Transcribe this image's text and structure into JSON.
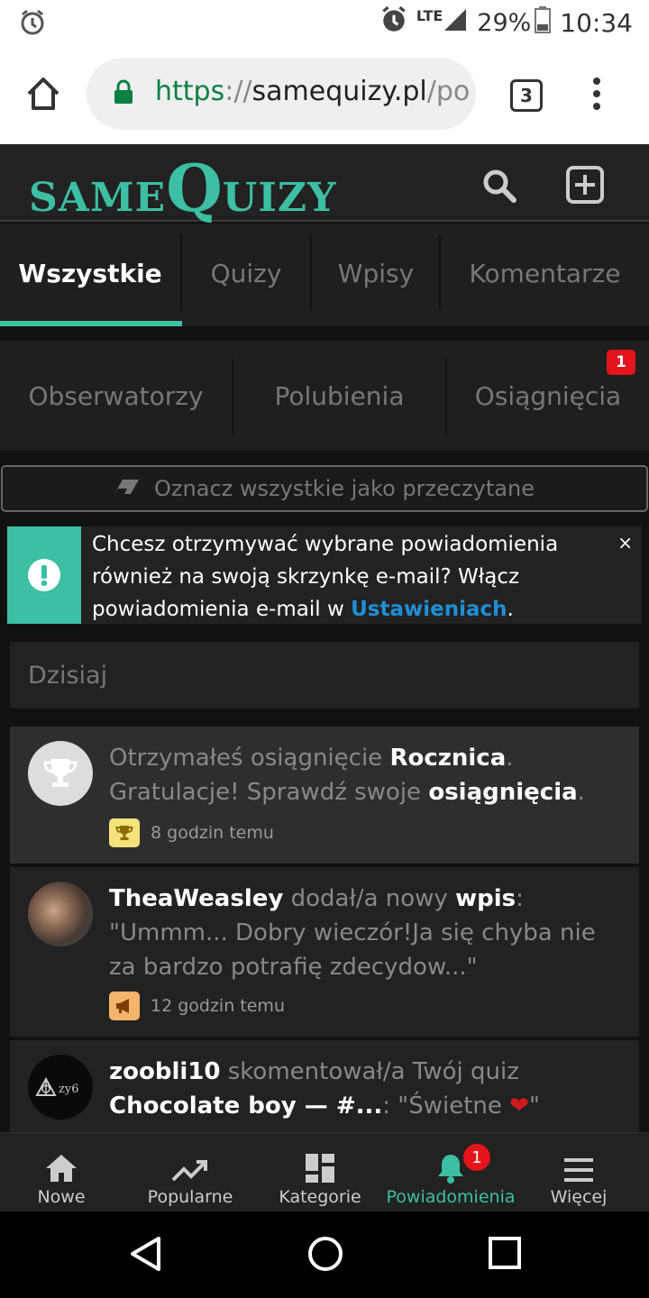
{
  "status_bar": {
    "lte": "LTE",
    "battery": "29%",
    "time": "10:34"
  },
  "browser": {
    "url_scheme": "https",
    "url_sep": "://",
    "url_host": "samequizy.pl",
    "url_path": "/po",
    "tab_count": "3"
  },
  "site": {
    "logo_same": "SAME",
    "logo_q": "Q",
    "logo_uizy": "UIZY"
  },
  "tabs_primary": [
    {
      "label": "Wszystkie"
    },
    {
      "label": "Quizy"
    },
    {
      "label": "Wpisy"
    },
    {
      "label": "Komentarze"
    }
  ],
  "tabs_secondary": [
    {
      "label": "Obserwatorzy"
    },
    {
      "label": "Polubienia"
    },
    {
      "label": "Osiągnięcia",
      "badge": "1"
    }
  ],
  "mark_read": {
    "label": "Oznacz wszystkie jako przeczytane"
  },
  "info_banner": {
    "text": "Chcesz otrzymywać wybrane powiadomienia również na swoją skrzynkę e-mail? Włącz powiadomienia e-mail w ",
    "link": "Ustawieniach",
    "end": ".",
    "close": "×"
  },
  "feed": {
    "section_title": "Dzisiaj",
    "items": [
      {
        "t1": "Otrzymałeś osiągnięcie ",
        "b1": "Rocznica",
        "t2": ". Gratulacje! Sprawdź swoje ",
        "b2": "osiągnięcia",
        "t3": ".",
        "time": "8 godzin temu"
      },
      {
        "b1": "TheaWeasley",
        "t1": " dodał/a nowy ",
        "b2": "wpis",
        "t2": ": \"Ummm... Dobry wieczór!Ja się chyba nie za bardzo potrafię zdecydow...\"",
        "time": "12 godzin temu"
      },
      {
        "b1": "zoobli10",
        "t1": " skomentował/a Twój quiz ",
        "b2": "Chocolate boy — #...",
        "t2": ": \"Świetne ",
        "t3": "\""
      }
    ]
  },
  "bottom_nav": [
    {
      "label": "Nowe"
    },
    {
      "label": "Popularne"
    },
    {
      "label": "Kategorie"
    },
    {
      "label": "Powiadomienia",
      "badge": "1"
    },
    {
      "label": "Więcej"
    }
  ],
  "colors": {
    "accent": "#3cbfa3",
    "badge": "#e3141b",
    "link": "#1e8fd6"
  }
}
